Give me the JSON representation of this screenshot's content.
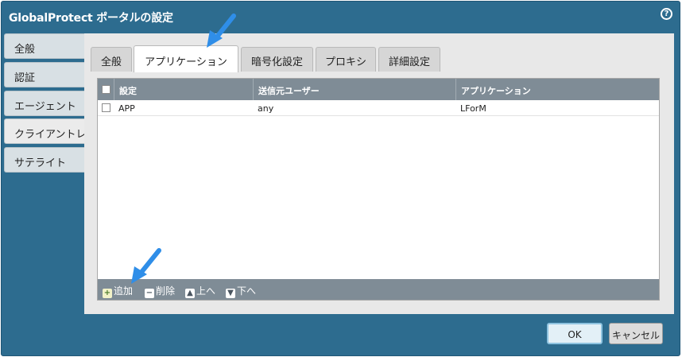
{
  "dialog": {
    "title": "GlobalProtect ポータルの設定",
    "help_icon": "?"
  },
  "sidebar": {
    "items": [
      {
        "label": "全般"
      },
      {
        "label": "認証"
      },
      {
        "label": "エージェント"
      },
      {
        "label": "クライアントレ"
      },
      {
        "label": "サテライト"
      }
    ]
  },
  "tabs": [
    {
      "label": "全般"
    },
    {
      "label": "アプリケーション"
    },
    {
      "label": "暗号化設定"
    },
    {
      "label": "プロキシ"
    },
    {
      "label": "詳細設定"
    }
  ],
  "table": {
    "columns": [
      "設定",
      "送信元ユーザー",
      "アプリケーション"
    ],
    "rows": [
      {
        "setting": "APP",
        "source_user": "any",
        "application": "LForM"
      }
    ]
  },
  "footer": {
    "add_label": "追加",
    "delete_label": "削除",
    "up_label": "上へ",
    "down_label": "下へ"
  },
  "buttons": {
    "ok_label": "OK",
    "cancel_label": "キャンセル"
  },
  "colors": {
    "dialog_bg": "#2d6c8f",
    "accent_arrow": "#2f8ee8",
    "grid_header": "#7f8c96"
  }
}
